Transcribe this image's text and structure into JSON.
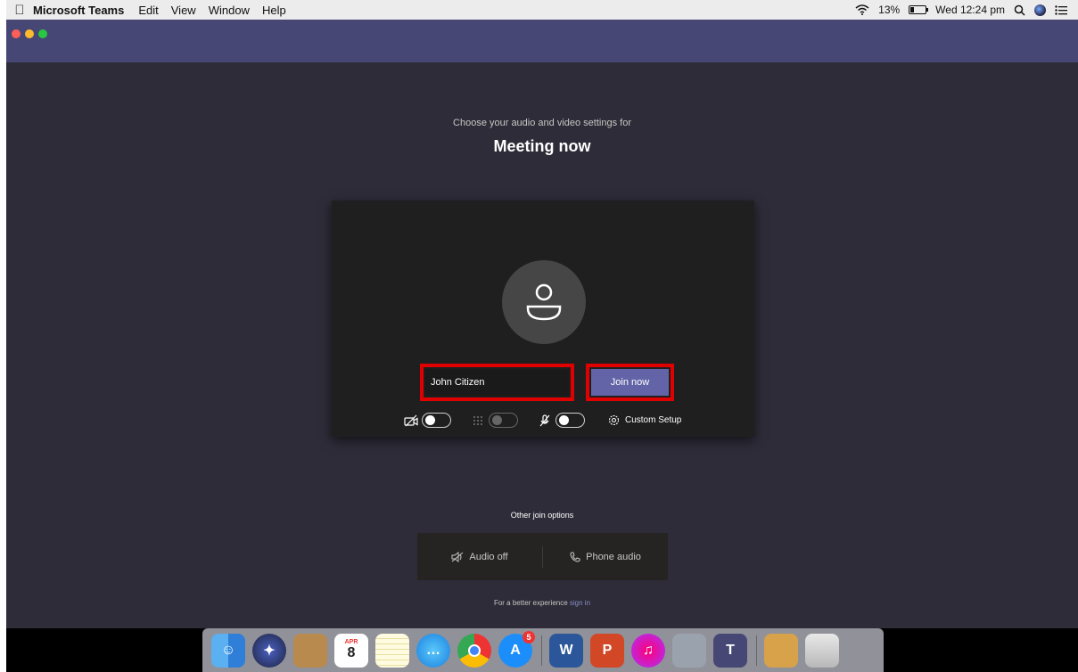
{
  "menubar": {
    "app_name": "Microsoft Teams",
    "menus": [
      "Edit",
      "View",
      "Window",
      "Help"
    ],
    "battery_text": "13%",
    "clock": "Wed 12:24 pm"
  },
  "prejoin": {
    "subtitle": "Choose your audio and video settings for",
    "meeting_title": "Meeting now",
    "name_value": "John Citizen",
    "join_label": "Join now",
    "custom_setup_label": "Custom Setup"
  },
  "other_options": {
    "label": "Other join options",
    "audio_off_label": "Audio off",
    "phone_audio_label": "Phone audio",
    "better_text": "For a better experience",
    "sign_in_label": "sign in"
  },
  "dock": {
    "apps": [
      "finder",
      "siri",
      "contacts",
      "calendar",
      "notes",
      "messages",
      "chrome",
      "app-store",
      "word",
      "powerpoint",
      "itunes",
      "preview",
      "teams",
      "archive-utility",
      "trash"
    ],
    "calendar_month": "APR",
    "calendar_day": "8",
    "app_store_badge": "5"
  },
  "colors": {
    "teams_purple": "#464775",
    "join_button": "#6264a7",
    "highlight_red": "#e00000",
    "background": "#2d2c38"
  }
}
